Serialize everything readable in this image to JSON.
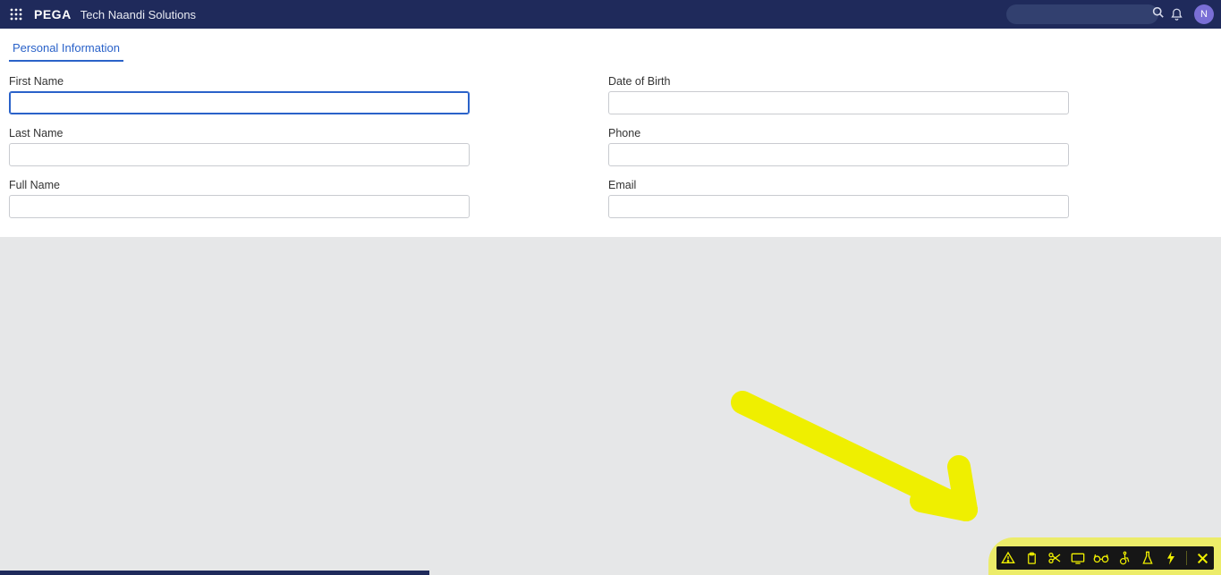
{
  "header": {
    "brand": "PEGA",
    "appName": "Tech Naandi Solutions",
    "searchValue": "",
    "avatarInitial": "N"
  },
  "tab": {
    "label": "Personal Information"
  },
  "form": {
    "firstName": {
      "label": "First Name",
      "value": ""
    },
    "lastName": {
      "label": "Last Name",
      "value": ""
    },
    "fullName": {
      "label": "Full Name",
      "value": ""
    },
    "dob": {
      "label": "Date of Birth",
      "value": ""
    },
    "phone": {
      "label": "Phone",
      "value": ""
    },
    "email": {
      "label": "Email",
      "value": ""
    }
  },
  "devToolbar": {
    "icons": [
      "alert",
      "clipboard",
      "scissors",
      "viewport",
      "glasses",
      "accessibility",
      "flask",
      "bolt",
      "close"
    ]
  }
}
